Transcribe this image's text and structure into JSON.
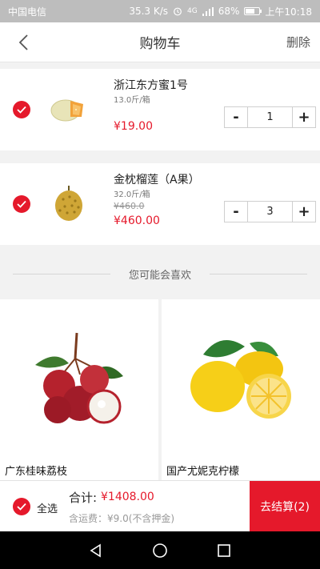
{
  "status": {
    "carrier": "中国电信",
    "speed": "35.3 K/s",
    "signal": "4G",
    "battery": "68%",
    "battery_level": 0.68,
    "time": "上午10:18"
  },
  "header": {
    "title": "购物车",
    "delete_label": "删除"
  },
  "cart": {
    "items": [
      {
        "name": "浙江东方蜜1号",
        "spec": "13.0斤/箱",
        "original_price": "",
        "price": "¥19.00",
        "qty": "1",
        "checked": true
      },
      {
        "name": "金枕榴莲（A果）",
        "spec": "32.0斤/箱",
        "original_price": "¥460.0",
        "price": "¥460.00",
        "qty": "3",
        "checked": true
      }
    ]
  },
  "recommend": {
    "heading": "您可能会喜欢",
    "items": [
      {
        "name": "广东桂味荔枝"
      },
      {
        "name": "国产尤妮克柠檬"
      }
    ]
  },
  "footer": {
    "select_all": "全选",
    "total_label": "合计:",
    "total": "¥1408.00",
    "shipping": "含运费：¥9.0(不含押金)",
    "checkout": "去结算(2)"
  },
  "colors": {
    "accent": "#e5192b"
  }
}
